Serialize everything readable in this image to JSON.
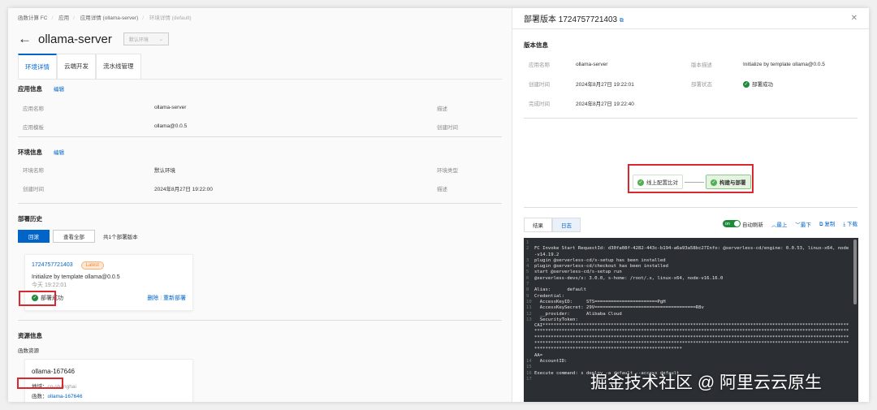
{
  "breadcrumb": [
    "函数计算 FC",
    "应用",
    "应用详情 (ollama-server)",
    "环境详情 (default)"
  ],
  "page": {
    "title": "ollama-server",
    "env_select": "默认环境"
  },
  "tabs": [
    "环境详情",
    "云端开发",
    "流水线管理"
  ],
  "app_info": {
    "title": "应用信息",
    "edit": "编辑",
    "rows": [
      [
        "应用名称",
        "ollama-server",
        "描述"
      ],
      [
        "应用模板",
        "ollama@0.0.5",
        "创建时间"
      ]
    ]
  },
  "env_info": {
    "title": "环境信息",
    "edit": "编辑",
    "rows": [
      [
        "环境名称",
        "默认环境",
        "环境类型"
      ],
      [
        "创建时间",
        "2024年8月27日 19:22:00",
        "描述"
      ]
    ]
  },
  "history": {
    "title": "部署历史",
    "rollback": "回滚",
    "view_all": "查看全部",
    "count": "共1个部署版本",
    "item": {
      "version": "1724757721403",
      "badge": "Latest",
      "desc": "Initialize by template ollama@0.0.5",
      "time": "今天 19:22:01",
      "status": "部署成功",
      "delete": "删除",
      "redeploy": "重新部署"
    }
  },
  "resources": {
    "title": "资源信息",
    "subtitle": "函数资源",
    "card": {
      "name": "ollama-167646",
      "region_label": "地域：",
      "region": "cn-shanghai",
      "func_label": "函数：",
      "func": "ollama-167646"
    }
  },
  "drawer": {
    "title": "部署版本 1724757721403",
    "section": "版本信息",
    "rows": [
      [
        "应用名称",
        "ollama-server",
        "版本描述",
        "Initialize by template ollama@0.0.5"
      ],
      [
        "创建时间",
        "2024年8月27日 19:22:01",
        "部署状态",
        "部署成功"
      ],
      [
        "完成时间",
        "2024年8月27日 19:22:40",
        "",
        ""
      ]
    ],
    "flow": [
      "线上配置比对",
      "构建与部署"
    ],
    "log_tabs": [
      "结果",
      "日志"
    ],
    "tools": {
      "toggle": "on",
      "auto": "自动刷新",
      "top": "最上",
      "bottom": "最下",
      "copy": "复制",
      "download": "下载"
    },
    "log": [
      [
        "1",
        ""
      ],
      [
        "2",
        "FC Invoke Start RequestId: d30fa08f-4282-443c-b194-a6a93a58bc27Info: @serverless-cd/engine: 0.0.53, linux-x64, node-v14.19.2"
      ],
      [
        "3",
        "plugin @serverless-cd/s-setup has been installed"
      ],
      [
        "4",
        "plugin @serverless-cd/checkout has been installed"
      ],
      [
        "5",
        "start @serverless-cd/s-setup run"
      ],
      [
        "6",
        "@serverless-devs/s: 3.0.0, s-home: /root/.s, linux-x64, node-v16.16.0"
      ],
      [
        "7",
        ""
      ],
      [
        "8",
        "Alias:      default"
      ],
      [
        "9",
        "Credential:"
      ],
      [
        "10",
        "  AccessKeyID:     STS=======================PgH"
      ],
      [
        "11",
        "  AccessKeySecret: 29V=====================================R8v"
      ],
      [
        "12",
        "  __provider:      Alibaba Cloud"
      ],
      [
        "13",
        "  SecurityToken:"
      ],
      [
        "",
        "CAI*******************************************************************************************************************************************************************************************************************************************************************************************************************************************************************************************************************************************************************************************************************************"
      ],
      [
        "",
        "AA="
      ],
      [
        "14",
        "  AccountID:"
      ],
      [
        "15",
        ""
      ],
      [
        "16",
        "Execute command: s deploy -a default --access default"
      ],
      [
        "17",
        ""
      ]
    ]
  },
  "watermark": "掘金技术社区 @ 阿里云云原生"
}
